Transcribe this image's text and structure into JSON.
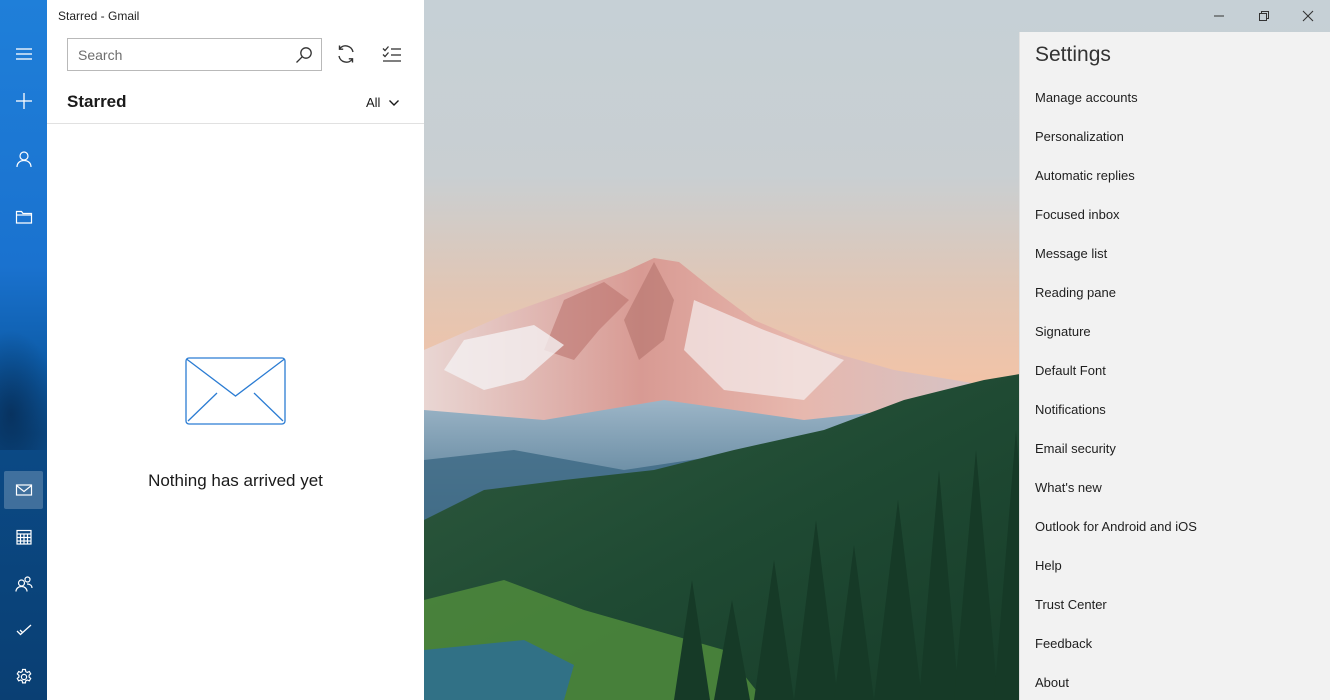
{
  "window": {
    "title": "Starred - Gmail"
  },
  "nav_rail": {
    "items": [
      {
        "icon": "hamburger-menu-icon"
      },
      {
        "icon": "new-mail-icon"
      },
      {
        "icon": "accounts-icon"
      },
      {
        "icon": "folders-icon"
      },
      {
        "icon": "mail-icon",
        "active": true
      },
      {
        "icon": "calendar-icon"
      },
      {
        "icon": "people-icon"
      },
      {
        "icon": "todo-icon"
      },
      {
        "icon": "settings-gear-icon"
      }
    ],
    "accent": "#1a72cf"
  },
  "list_pane": {
    "search_placeholder": "Search",
    "folder_name": "Starred",
    "filter_value": "All",
    "empty_message": "Nothing has arrived yet",
    "empty_icon": "envelope-icon",
    "empty_icon_color": "#2b7cd3"
  },
  "settings": {
    "title": "Settings",
    "items": [
      "Manage accounts",
      "Personalization",
      "Automatic replies",
      "Focused inbox",
      "Message list",
      "Reading pane",
      "Signature",
      "Default Font",
      "Notifications",
      "Email security",
      "What's new",
      "Outlook for Android and iOS",
      "Help",
      "Trust Center",
      "Feedback",
      "About"
    ]
  }
}
